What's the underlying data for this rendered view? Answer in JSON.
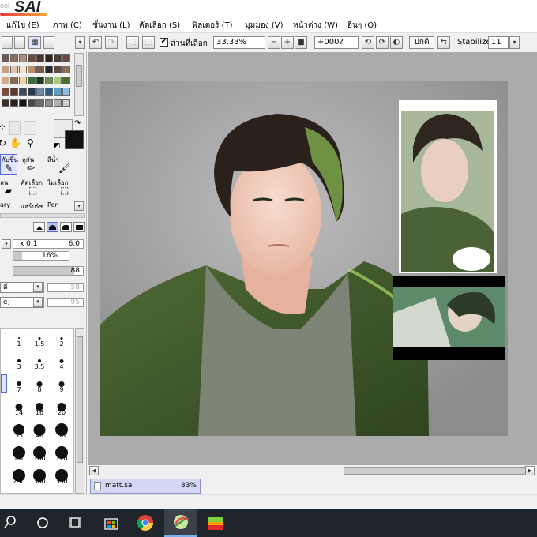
{
  "app": {
    "logo_small": "ool",
    "logo_big": "SAI"
  },
  "menu": {
    "items": [
      "แก้ไข (E)",
      "ภาพ (C)",
      "ชั้นงาน (L)",
      "คัดเลือก (S)",
      "ฟิลเตอร์ (T)",
      "มุมมอง (V)",
      "หน้าต่าง (W)",
      "อื่นๆ (O)"
    ]
  },
  "toolbar": {
    "selection_checkbox_checked": true,
    "show_selection_label": "ส่วนที่เลือก",
    "zoom_value": "33.33%",
    "rotation_value": "+000?",
    "mode_value": "ปกติ",
    "stabilize_label": "Stabilize",
    "stabilize_value": "11",
    "undo_icon": "undo-icon",
    "redo_icon": "redo-icon"
  },
  "color_panel": {
    "swatches": [
      [
        "#6b5a58",
        "#8c6f64",
        "#b08f7a",
        "#6c4a3f",
        "#4a3530",
        "#2f2622",
        "#4f3b35",
        "#6a4c43"
      ],
      [
        "#c79d82",
        "#e1c4a8",
        "#f6e4c8",
        "#b88d6a",
        "#7c5b46",
        "#2a2a2a",
        "#5d4a41",
        "#89705f"
      ],
      [
        "#d2aa8c",
        "#8a6a55",
        "#f0d4a8",
        "#3a6a3a",
        "#1e3a1e",
        "#6f8f56",
        "#a7c77a",
        "#496b2e"
      ],
      [
        "#7a4a3a",
        "#5e3a2e",
        "#3b4b5a",
        "#2a3a4a",
        "#6a8aaa",
        "#2e5c8a",
        "#5aa0c8",
        "#8fbde0"
      ],
      [
        "#3d2f2a",
        "#2b201c",
        "#1a1410",
        "#4a4a4a",
        "#6d6d6d",
        "#8e8e8e",
        "#b0b0b0",
        "#d0d0d0"
      ]
    ],
    "primary_color": "#111111",
    "secondary_color": "#ebebeb"
  },
  "tools": {
    "row1": [
      "กับชิ้น",
      "ถูกัน",
      "สีน้ำ"
    ],
    "row2": [
      "ลน",
      "คัดเลือก",
      "ไม่เลือก"
    ],
    "row3": [
      "ary",
      "แฮร์บรัช",
      "Pen"
    ]
  },
  "brush_settings": {
    "size_multiplier": "x 0.1",
    "size_value": "6.0",
    "min_size_value": "16%",
    "min_size_level": 0.16,
    "density_value": "88",
    "density_level": 0.88,
    "blend_label": "ดี",
    "blend_value": "58",
    "texture_label": "e)",
    "texture_value": "95"
  },
  "brush_sizes": {
    "labels": [
      "1",
      "1.5",
      "2",
      "3",
      "3.5",
      "4",
      "7",
      "8",
      "9",
      "14",
      "16",
      "20",
      "35",
      "40",
      "50",
      "80",
      "100",
      "120",
      "250",
      "300",
      "350"
    ]
  },
  "document": {
    "tab_name": "matt.sai",
    "tab_zoom": "33%"
  },
  "taskbar": {
    "icons": [
      "search-icon",
      "cortana-icon",
      "task-view-icon",
      "store-icon",
      "chrome-icon",
      "paint-tool-sai-icon",
      "bluestacks-icon"
    ]
  }
}
